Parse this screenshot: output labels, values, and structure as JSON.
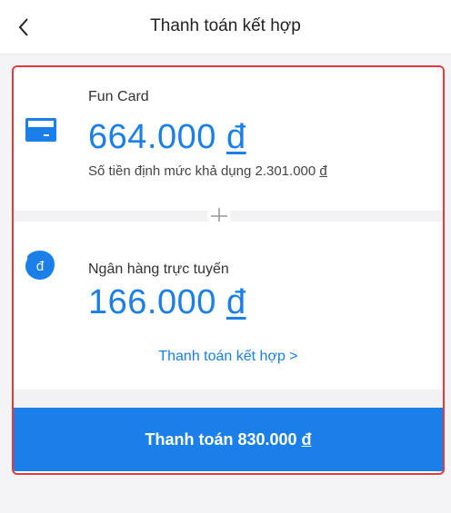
{
  "header": {
    "title": "Thanh toán kết hợp"
  },
  "funcard": {
    "label": "Fun Card",
    "amount": "664.000",
    "currency": "đ",
    "limit_text": "Số tiền định mức khả dụng 2.301.000",
    "limit_currency": "đ"
  },
  "bank": {
    "label": "Ngân hàng trực tuyến",
    "amount": "166.000",
    "currency": "đ",
    "icon_text": "đ"
  },
  "combo": {
    "link_label": "Thanh toán kết hợp",
    "link_chevron": ">"
  },
  "pay": {
    "label": "Thanh toán 830.000",
    "currency": "đ"
  },
  "colors": {
    "accent": "#1a7fe8",
    "highlight_outline": "#e8393a"
  }
}
